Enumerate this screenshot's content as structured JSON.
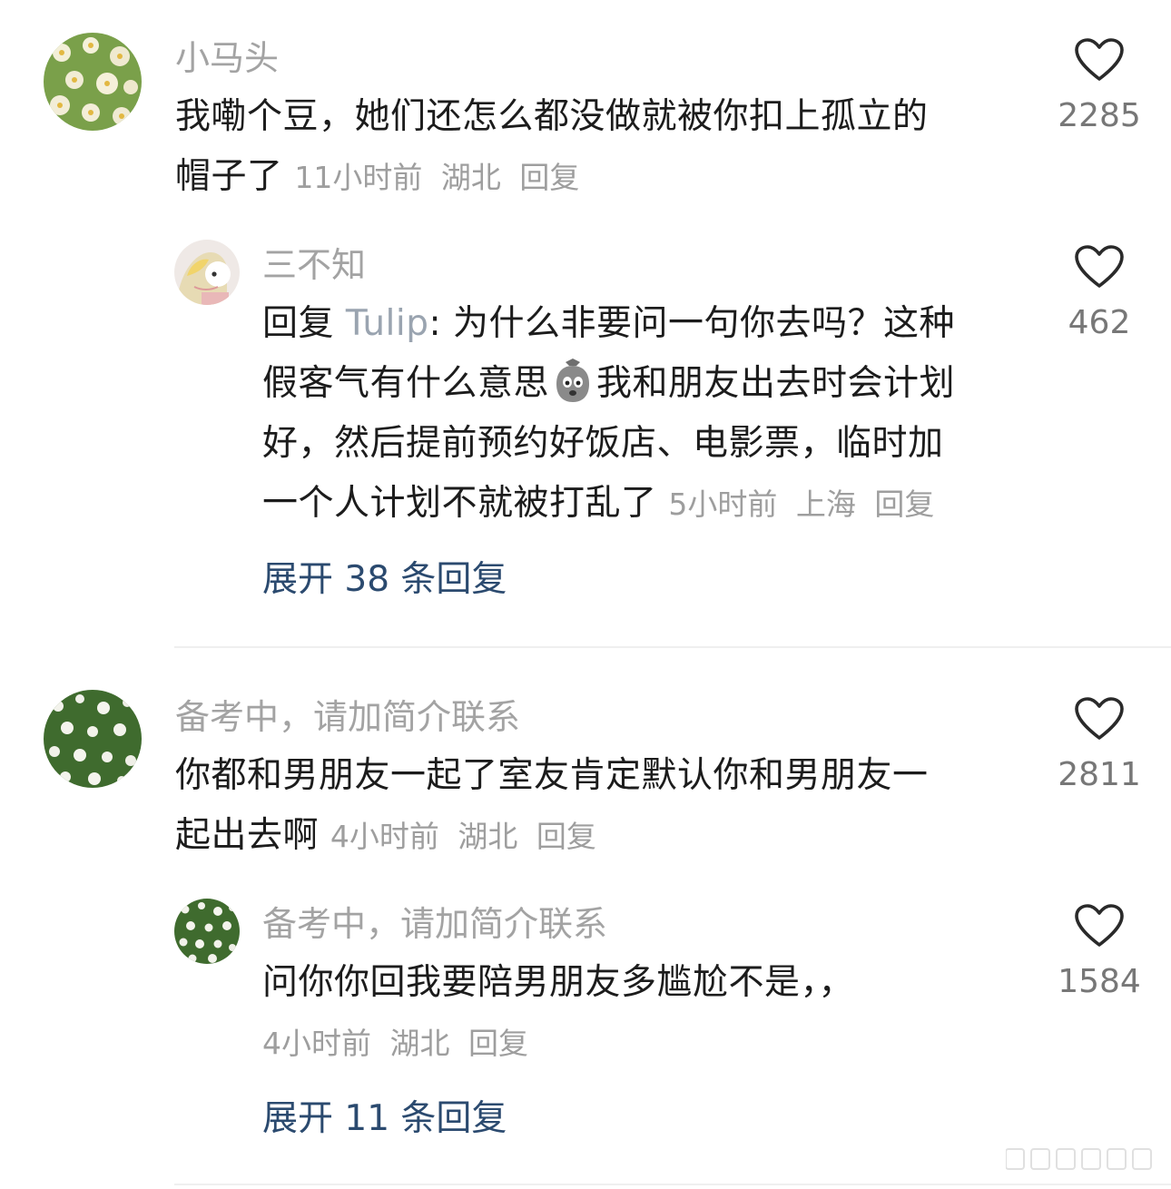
{
  "comments": [
    {
      "username": "小马头",
      "text": "我嘞个豆，她们还怎么都没做就被你扣上孤立的帽子了",
      "line1": "我嘞个豆，她们还怎么都没做就被你扣上孤立的",
      "line2": "帽子了",
      "time": "11小时前",
      "location": "湖北",
      "reply_label": "回复",
      "likes": "2285"
    },
    {
      "username": "三不知",
      "reply_prefix": "回复",
      "mention": "Tulip",
      "line1_rest": ": 为什么非要问一句你去吗？这种",
      "line2a": "假客气有什么意思",
      "line2b": "我和朋友出去时会计划",
      "line3": "好，然后提前预约好饭店、电影票，临时加",
      "line4": "一个人计划不就被打乱了",
      "time": "5小时前",
      "location": "上海",
      "reply_label": "回复",
      "likes": "462",
      "emoji": "crying-bag-emoji"
    },
    {
      "username": "备考中，请加简介联系",
      "line1": "你都和男朋友一起了室友肯定默认你和男朋友一",
      "line2": "起出去啊",
      "time": "4小时前",
      "location": "湖北",
      "reply_label": "回复",
      "likes": "2811"
    },
    {
      "username": "备考中，请加简介联系",
      "line1": "问你你回我要陪男朋友多尴尬不是，，",
      "time": "4小时前",
      "location": "湖北",
      "reply_label": "回复",
      "likes": "1584"
    }
  ],
  "expand_1": "展开 38 条回复",
  "expand_2": "展开 11 条回复",
  "colors": {
    "expand_link": "#2b4a6f",
    "meta_gray": "#9e9e9e",
    "username_gray": "#a3a3a3"
  }
}
